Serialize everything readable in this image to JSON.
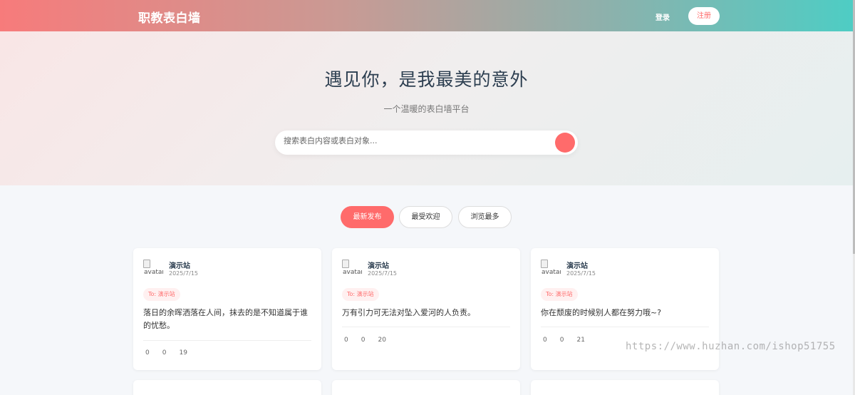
{
  "navbar": {
    "brand": "职教表白墙",
    "login_label": "登录",
    "register_label": "注册"
  },
  "hero": {
    "title": "遇见你，是我最美的意外",
    "subtitle": "一个温暖的表白墙平台",
    "search": {
      "placeholder": "搜索表白内容或表白对象..."
    }
  },
  "tabs": [
    {
      "label": "最新发布",
      "active": true
    },
    {
      "label": "最受欢迎",
      "active": false
    },
    {
      "label": "浏览最多",
      "active": false
    }
  ],
  "cards": [
    {
      "avatar_alt": "avatar",
      "author": "演示站",
      "date": "2025/7/15",
      "to": "To: 演示站",
      "content": "落日的余晖洒落在人间，抹去的是不知道属于谁的忧愁。",
      "likes": "0",
      "comments": "0",
      "views": "19"
    },
    {
      "avatar_alt": "avatar",
      "author": "演示站",
      "date": "2025/7/15",
      "to": "To: 演示站",
      "content": "万有引力可无法对坠入爱河的人负责。",
      "likes": "0",
      "comments": "0",
      "views": "20"
    },
    {
      "avatar_alt": "avatar",
      "author": "演示站",
      "date": "2025/7/15",
      "to": "To: 演示站",
      "content": "你在颓废的时候别人都在努力哦~?",
      "likes": "0",
      "comments": "0",
      "views": "21"
    }
  ],
  "watermark": "https://www.huzhan.com/ishop51755",
  "colors": {
    "accent": "#ff6b6b",
    "teal": "#4ecdc4",
    "title": "#2c3e50"
  }
}
